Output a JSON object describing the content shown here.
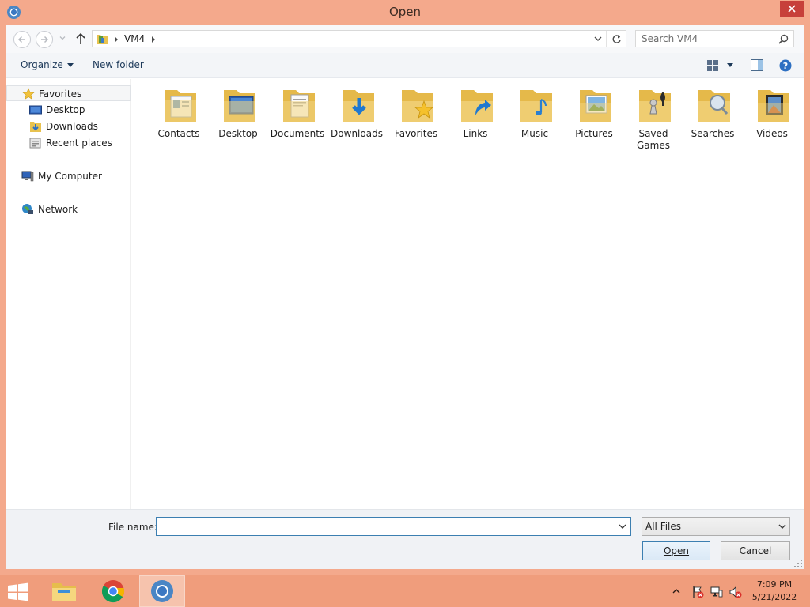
{
  "window": {
    "title": "Open",
    "app_icon": "chrome-canary-icon",
    "frame_color": "#f4a98c",
    "close_color": "#c7403a"
  },
  "address": {
    "location_icon": "library-folder-icon",
    "crumbs": [
      "VM4"
    ],
    "search_placeholder": "Search VM4"
  },
  "toolbar": {
    "organize_label": "Organize",
    "new_folder_label": "New folder"
  },
  "navpane": {
    "items": [
      {
        "label": "Favorites",
        "icon": "star-icon"
      },
      {
        "label": "Desktop",
        "icon": "desktop-icon"
      },
      {
        "label": "Downloads",
        "icon": "downloads-icon"
      },
      {
        "label": "Recent places",
        "icon": "recent-places-icon"
      },
      {
        "label": "My Computer",
        "icon": "computer-icon"
      },
      {
        "label": "Network",
        "icon": "network-icon"
      }
    ]
  },
  "folders": [
    {
      "label": "Contacts",
      "icon": "contacts-folder-icon"
    },
    {
      "label": "Desktop",
      "icon": "desktop-folder-icon"
    },
    {
      "label": "Documents",
      "icon": "documents-folder-icon"
    },
    {
      "label": "Downloads",
      "icon": "downloads-folder-icon"
    },
    {
      "label": "Favorites",
      "icon": "favorites-folder-icon"
    },
    {
      "label": "Links",
      "icon": "links-folder-icon"
    },
    {
      "label": "Music",
      "icon": "music-folder-icon"
    },
    {
      "label": "Pictures",
      "icon": "pictures-folder-icon"
    },
    {
      "label": "Saved Games",
      "icon": "saved-games-folder-icon"
    },
    {
      "label": "Searches",
      "icon": "searches-folder-icon"
    },
    {
      "label": "Videos",
      "icon": "videos-folder-icon"
    }
  ],
  "footer": {
    "file_name_label": "File name:",
    "file_name_value": "",
    "filter_value": "All Files",
    "open_label": "Open",
    "cancel_label": "Cancel"
  },
  "taskbar": {
    "apps": [
      "file-explorer-icon",
      "chrome-icon",
      "chrome-canary-icon"
    ],
    "active_app": "chrome-canary-icon",
    "time": "7:09 PM",
    "date": "5/21/2022"
  }
}
